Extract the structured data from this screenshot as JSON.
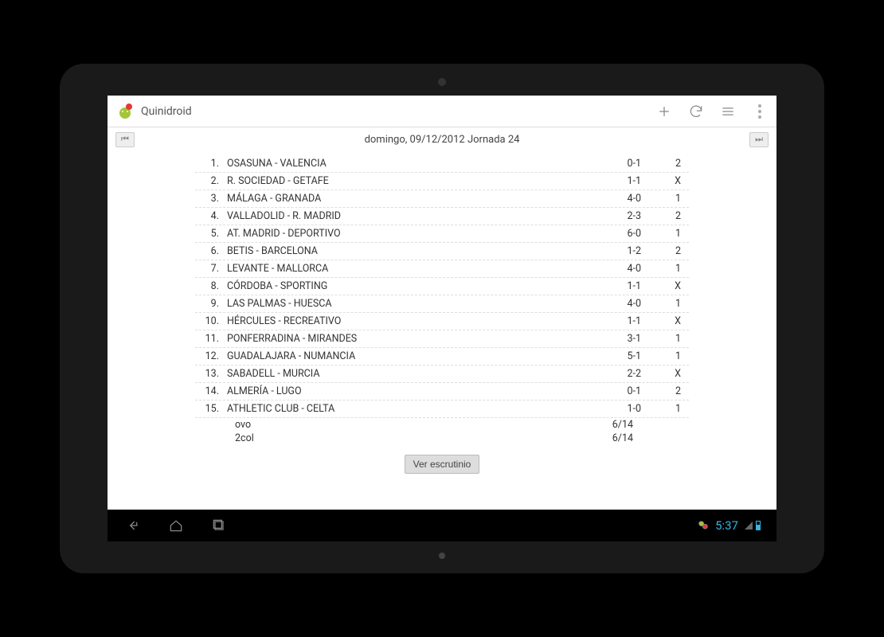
{
  "app": {
    "title": "Quinidroid"
  },
  "nav": {
    "date_title": "domingo, 09/12/2012  Jornada 24"
  },
  "matches": [
    {
      "num": "1.",
      "teams": "OSASUNA - VALENCIA",
      "score": "0-1",
      "result": "2"
    },
    {
      "num": "2.",
      "teams": "R. SOCIEDAD - GETAFE",
      "score": "1-1",
      "result": "X"
    },
    {
      "num": "3.",
      "teams": "MÁLAGA - GRANADA",
      "score": "4-0",
      "result": "1"
    },
    {
      "num": "4.",
      "teams": "VALLADOLID - R. MADRID",
      "score": "2-3",
      "result": "2"
    },
    {
      "num": "5.",
      "teams": "AT. MADRID - DEPORTIVO",
      "score": "6-0",
      "result": "1"
    },
    {
      "num": "6.",
      "teams": "BETIS - BARCELONA",
      "score": "1-2",
      "result": "2"
    },
    {
      "num": "7.",
      "teams": "LEVANTE - MALLORCA",
      "score": "4-0",
      "result": "1"
    },
    {
      "num": "8.",
      "teams": "CÓRDOBA - SPORTING",
      "score": "1-1",
      "result": "X"
    },
    {
      "num": "9.",
      "teams": "LAS PALMAS - HUESCA",
      "score": "4-0",
      "result": "1"
    },
    {
      "num": "10.",
      "teams": "HÉRCULES - RECREATIVO",
      "score": "1-1",
      "result": "X"
    },
    {
      "num": "11.",
      "teams": "PONFERRADINA - MIRANDES",
      "score": "3-1",
      "result": "1"
    },
    {
      "num": "12.",
      "teams": "GUADALAJARA - NUMANCIA",
      "score": "5-1",
      "result": "1"
    },
    {
      "num": "13.",
      "teams": "SABADELL - MURCIA",
      "score": "2-2",
      "result": "X"
    },
    {
      "num": "14.",
      "teams": "ALMERÍA - LUGO",
      "score": "0-1",
      "result": "2"
    },
    {
      "num": "15.",
      "teams": "ATHLETIC CLUB - CELTA",
      "score": "1-0",
      "result": "1"
    }
  ],
  "summaries": [
    {
      "label": "ovo",
      "value": "6/14"
    },
    {
      "label": "2col",
      "value": "6/14"
    }
  ],
  "button": {
    "scrutiny": "Ver escrutinio"
  },
  "navbar": {
    "prev": "⏮",
    "next": "⏭"
  },
  "system": {
    "clock": "5:37"
  }
}
